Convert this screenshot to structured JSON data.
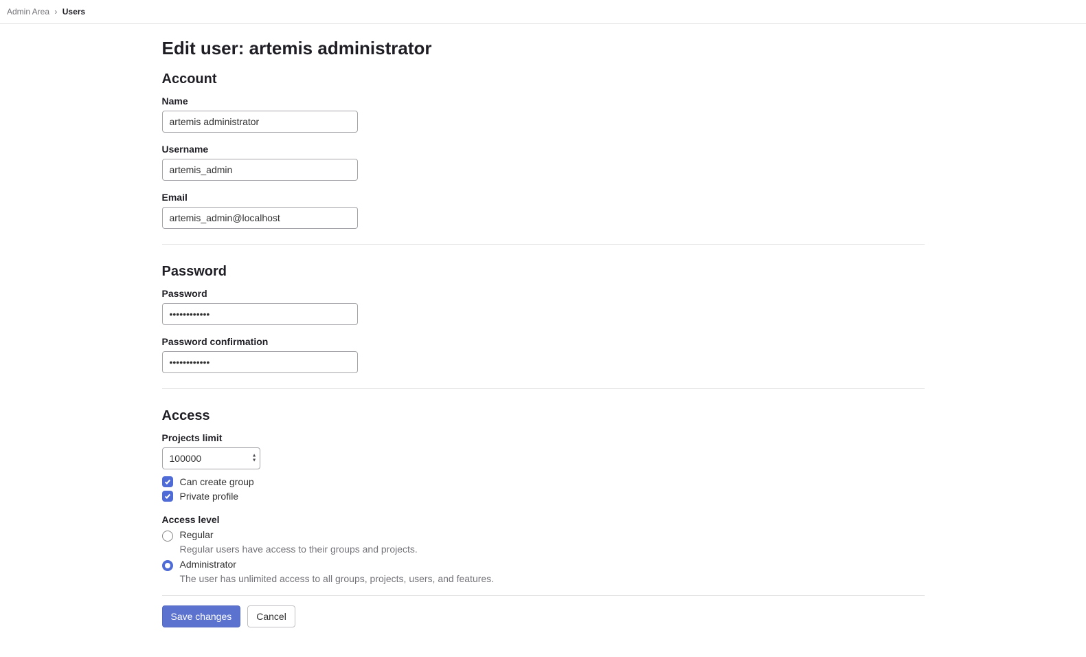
{
  "breadcrumb": {
    "parent": "Admin Area",
    "current": "Users"
  },
  "page_title": "Edit user: artemis administrator",
  "sections": {
    "account": {
      "title": "Account",
      "name_label": "Name",
      "name_value": "artemis administrator",
      "username_label": "Username",
      "username_value": "artemis_admin",
      "email_label": "Email",
      "email_value": "artemis_admin@localhost"
    },
    "password": {
      "title": "Password",
      "password_label": "Password",
      "password_value": "••••••••••••",
      "confirm_label": "Password confirmation",
      "confirm_value": "••••••••••••"
    },
    "access": {
      "title": "Access",
      "projects_limit_label": "Projects limit",
      "projects_limit_value": "100000",
      "can_create_group_label": "Can create group",
      "can_create_group_checked": true,
      "private_profile_label": "Private profile",
      "private_profile_checked": true,
      "access_level_label": "Access level",
      "regular_label": "Regular",
      "regular_help": "Regular users have access to their groups and projects.",
      "admin_label": "Administrator",
      "admin_help": "The user has unlimited access to all groups, projects, users, and features.",
      "selected_level": "admin"
    }
  },
  "actions": {
    "save": "Save changes",
    "cancel": "Cancel"
  }
}
